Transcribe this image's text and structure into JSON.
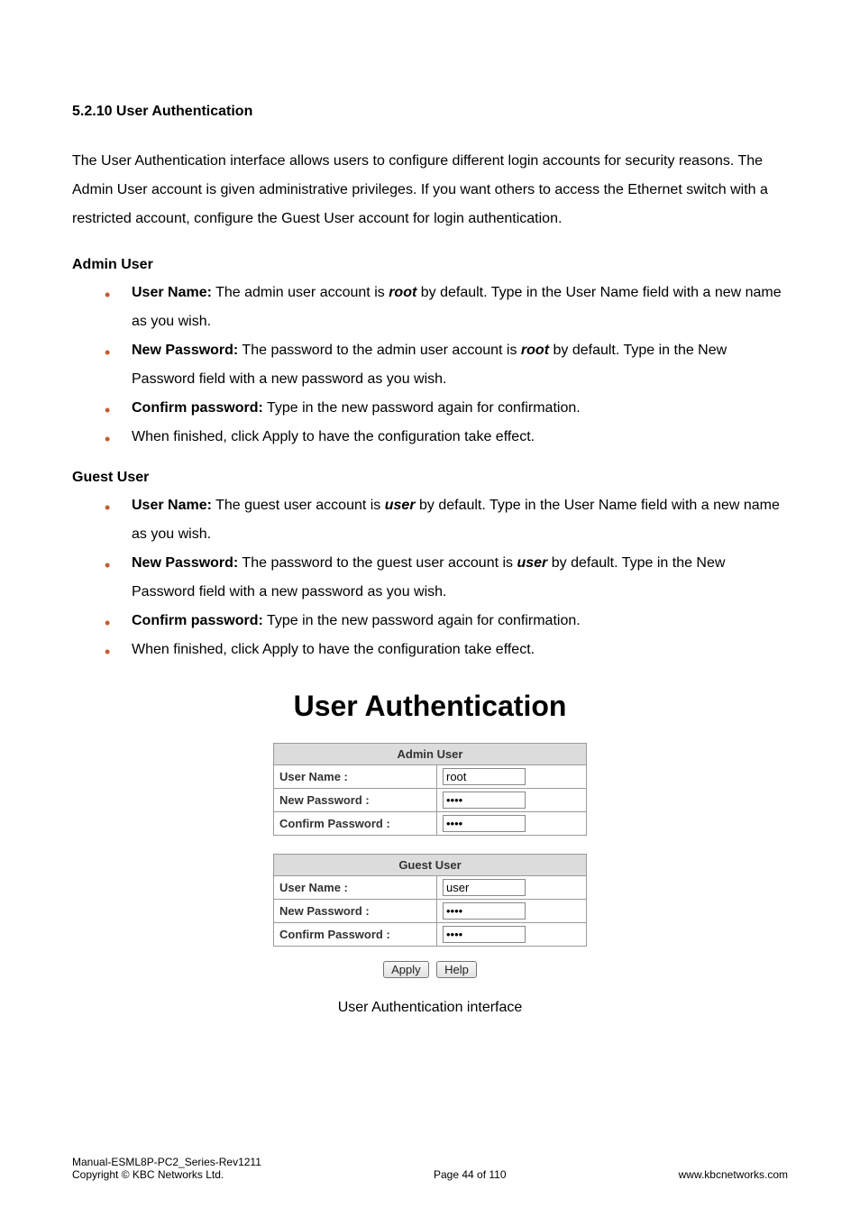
{
  "heading": "5.2.10 User Authentication",
  "intro": "The User Authentication interface allows users to configure different login accounts for security reasons. The Admin User account is given administrative privileges. If you want others to access the Ethernet switch with a restricted account, configure the Guest User account for login authentication.",
  "admin": {
    "title": "Admin User",
    "items": {
      "un_label": "User Name:",
      "un_pre": " The admin user account is ",
      "un_em": "root",
      "un_post": " by default. Type in the User Name field with a new name as you wish.",
      "np_label": "New Password:",
      "np_pre": " The password to the admin user account is ",
      "np_em": "root",
      "np_post": " by default. Type in the New Password field with a new password as you wish.",
      "cp_label": "Confirm password:",
      "cp_text": " Type in the new password again for confirmation.",
      "fin": "When finished, click Apply to have the configuration take effect."
    }
  },
  "guest": {
    "title": "Guest User",
    "items": {
      "un_label": "User Name:",
      "un_pre": " The guest user account is ",
      "un_em": "user",
      "un_post": " by default. Type in the User Name field with a new name as you wish.",
      "np_label": "New Password:",
      "np_pre": " The password to the guest user account is ",
      "np_em": "user",
      "np_post": " by default. Type in the New Password field with a new password as you wish.",
      "cp_label": "Confirm password:",
      "cp_text": " Type in the new password again for confirmation.",
      "fin": "When finished, click Apply to have the configuration take effect."
    }
  },
  "panel": {
    "title": "User Authentication",
    "admin_header": "Admin User",
    "guest_header": "Guest User",
    "labels": {
      "user_name": "User Name :",
      "new_password": "New Password :",
      "confirm_password": "Confirm Password :"
    },
    "admin_values": {
      "user_name": "root",
      "new_password": "••••",
      "confirm_password": "••••"
    },
    "guest_values": {
      "user_name": "user",
      "new_password": "••••",
      "confirm_password": "••••"
    },
    "buttons": {
      "apply": "Apply",
      "help": "Help"
    },
    "caption": "User Authentication interface"
  },
  "footer": {
    "manual": "Manual-ESML8P-PC2_Series-Rev1211",
    "copyright": "Copyright © KBC Networks Ltd.",
    "page": "Page 44 of 110",
    "url": "www.kbcnetworks.com"
  }
}
